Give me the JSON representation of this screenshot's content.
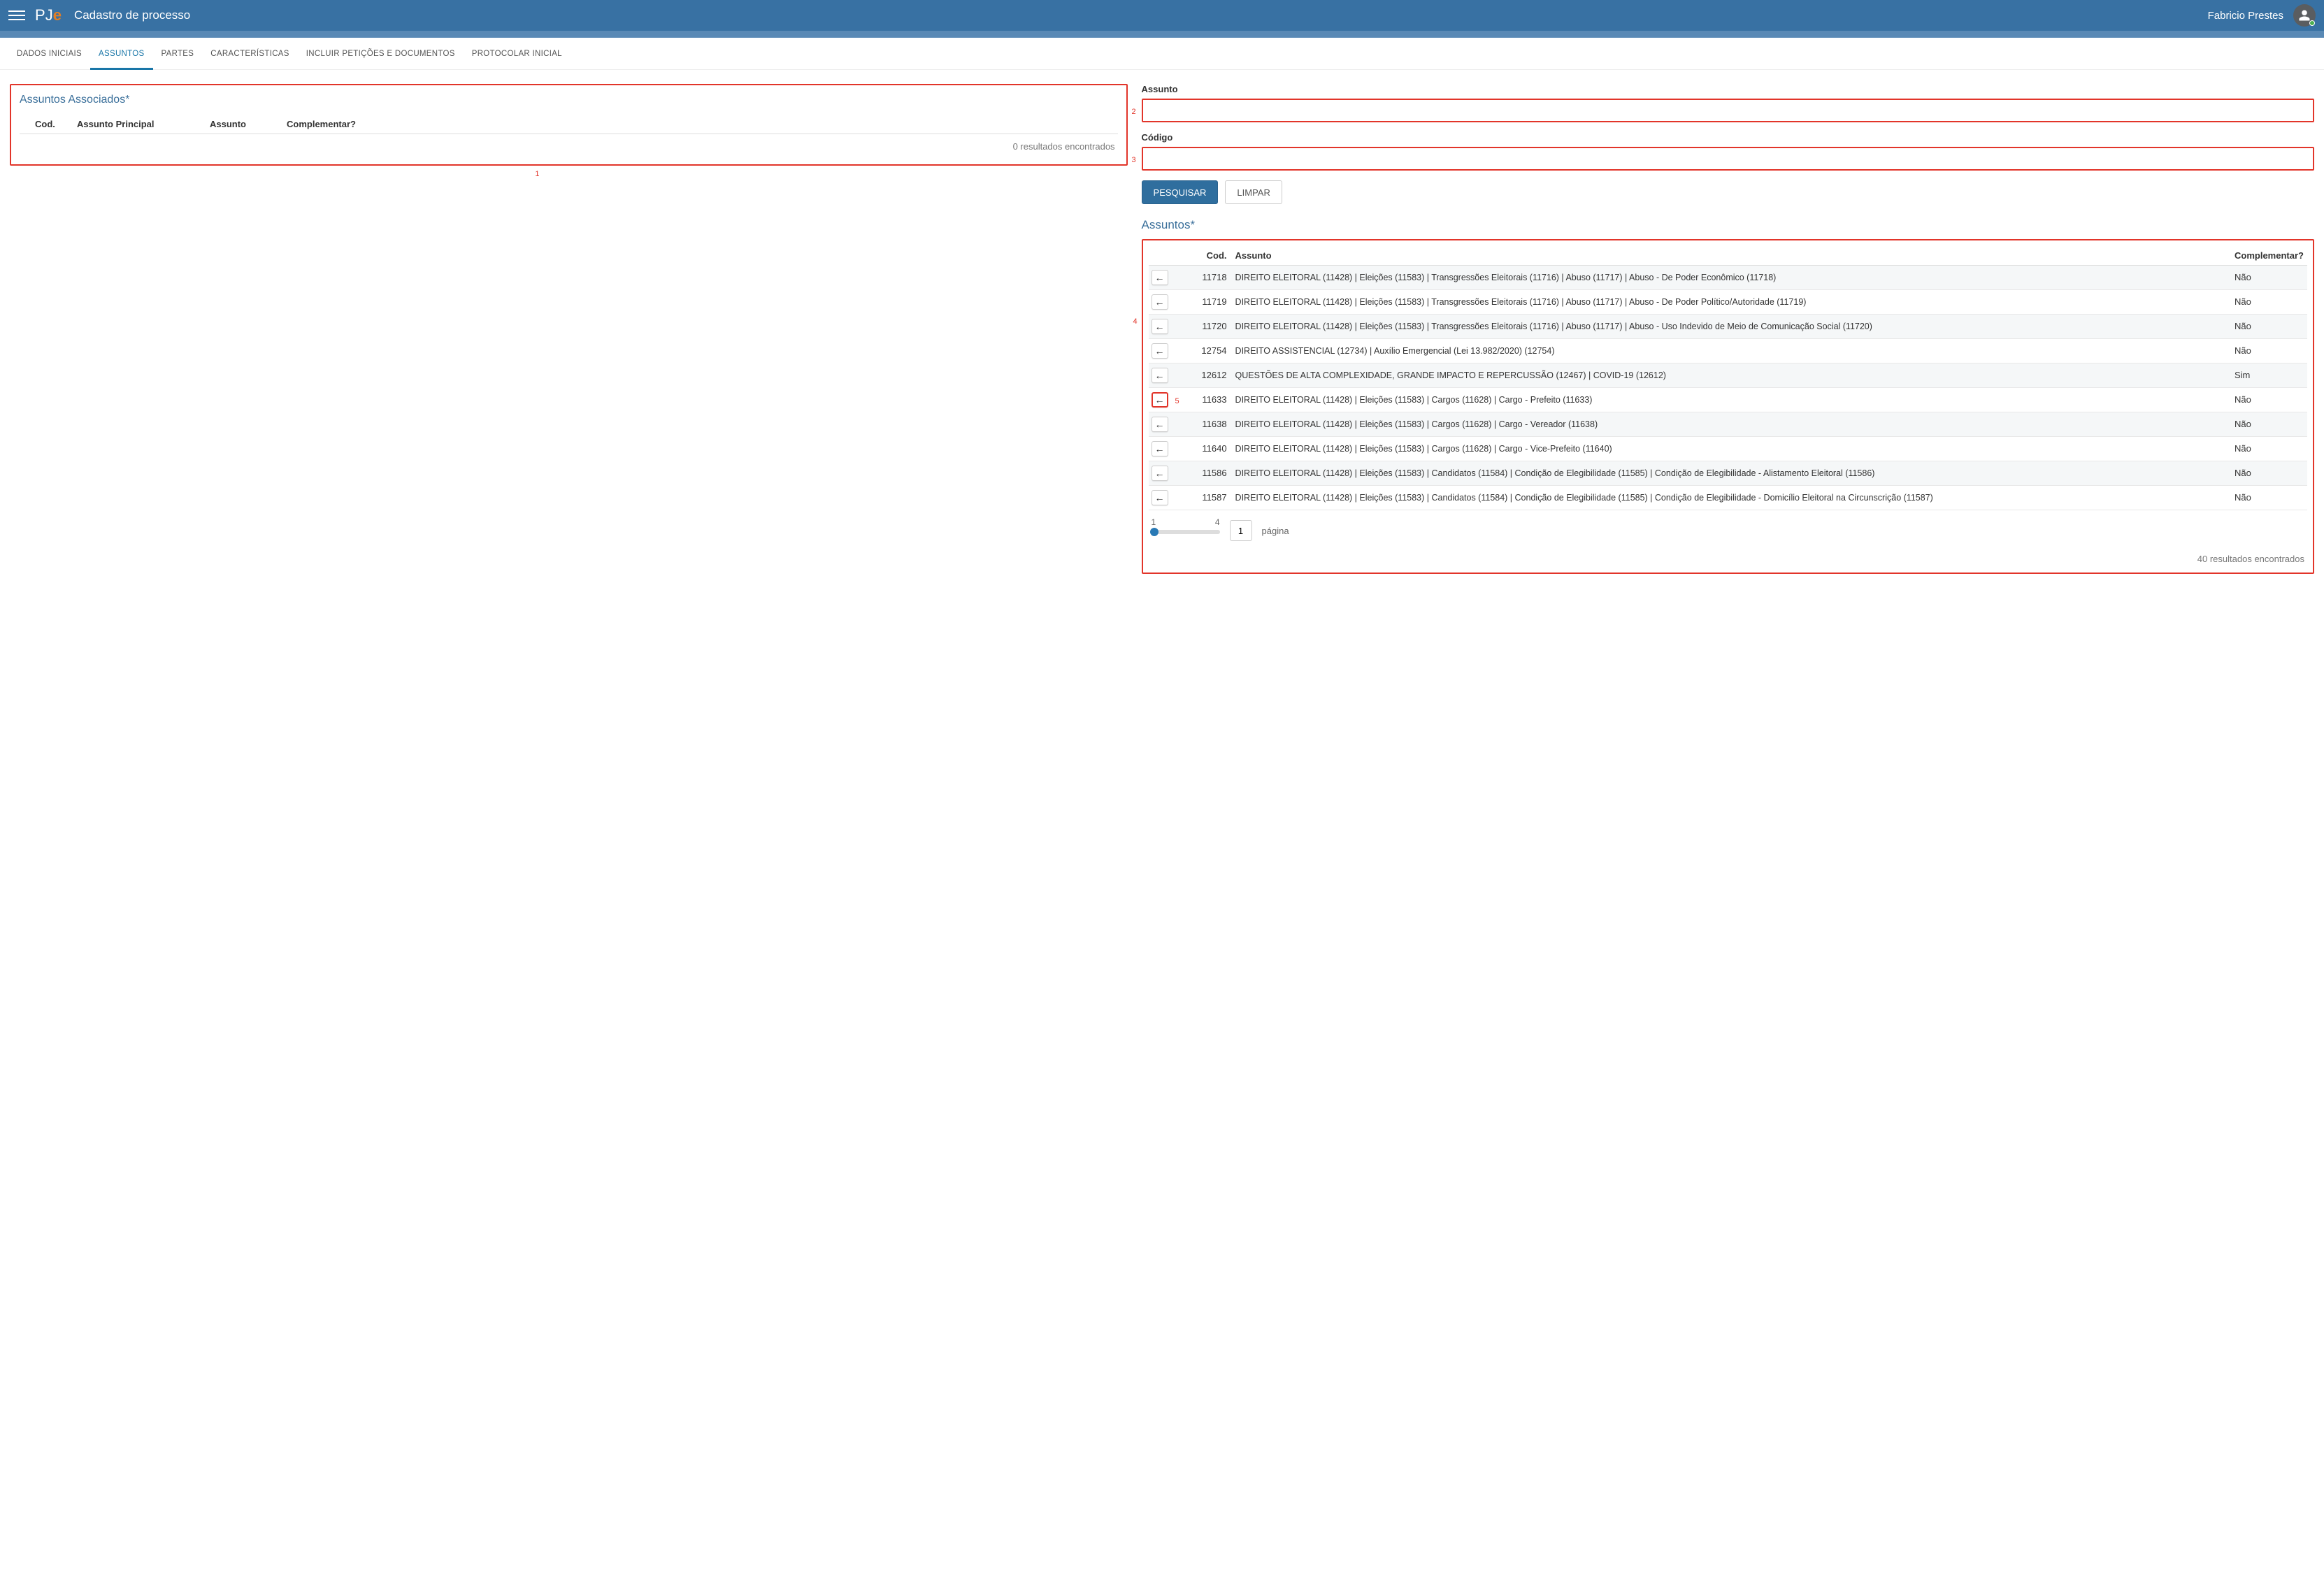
{
  "header": {
    "page_title": "Cadastro de processo",
    "user_name": "Fabricio Prestes",
    "logo_p": "P",
    "logo_j": "J",
    "logo_e": "e"
  },
  "tabs": [
    {
      "label": "DADOS INICIAIS",
      "active": false
    },
    {
      "label": "ASSUNTOS",
      "active": true
    },
    {
      "label": "PARTES",
      "active": false
    },
    {
      "label": "CARACTERÍSTICAS",
      "active": false
    },
    {
      "label": "INCLUIR PETIÇÕES E DOCUMENTOS",
      "active": false
    },
    {
      "label": "PROTOCOLAR INICIAL",
      "active": false
    }
  ],
  "left": {
    "title": "Assuntos Associados*",
    "cols": {
      "cod": "Cod.",
      "principal": "Assunto Principal",
      "assunto": "Assunto",
      "comp": "Complementar?"
    },
    "empty": "0 resultados encontrados",
    "callout": "1"
  },
  "search": {
    "assunto_label": "Assunto",
    "assunto_callout": "2",
    "codigo_label": "Código",
    "codigo_callout": "3",
    "btn_search": "PESQUISAR",
    "btn_clear": "LIMPAR"
  },
  "results": {
    "title": "Assuntos*",
    "callout_box": "4",
    "callout_row": "5",
    "cols": {
      "cod": "Cod.",
      "assunto": "Assunto",
      "comp": "Complementar?"
    },
    "rows": [
      {
        "cod": "11718",
        "desc": "DIREITO ELEITORAL (11428) | Eleições (11583) | Transgressões Eleitorais (11716) | Abuso (11717) | Abuso - De Poder Econômico (11718)",
        "comp": "Não",
        "highlight": false
      },
      {
        "cod": "11719",
        "desc": "DIREITO ELEITORAL (11428) | Eleições (11583) | Transgressões Eleitorais (11716) | Abuso (11717) | Abuso - De Poder Político/Autoridade (11719)",
        "comp": "Não",
        "highlight": false
      },
      {
        "cod": "11720",
        "desc": "DIREITO ELEITORAL (11428) | Eleições (11583) | Transgressões Eleitorais (11716) | Abuso (11717) | Abuso - Uso Indevido de Meio de Comunicação Social (11720)",
        "comp": "Não",
        "highlight": false
      },
      {
        "cod": "12754",
        "desc": "DIREITO ASSISTENCIAL (12734) | Auxílio Emergencial (Lei 13.982/2020) (12754)",
        "comp": "Não",
        "highlight": false
      },
      {
        "cod": "12612",
        "desc": "QUESTÕES DE ALTA COMPLEXIDADE, GRANDE IMPACTO E REPERCUSSÃO (12467) | COVID-19 (12612)",
        "comp": "Sim",
        "highlight": false
      },
      {
        "cod": "11633",
        "desc": "DIREITO ELEITORAL (11428) | Eleições (11583) | Cargos (11628) | Cargo - Prefeito (11633)",
        "comp": "Não",
        "highlight": true
      },
      {
        "cod": "11638",
        "desc": "DIREITO ELEITORAL (11428) | Eleições (11583) | Cargos (11628) | Cargo - Vereador (11638)",
        "comp": "Não",
        "highlight": false
      },
      {
        "cod": "11640",
        "desc": "DIREITO ELEITORAL (11428) | Eleições (11583) | Cargos (11628) | Cargo - Vice-Prefeito (11640)",
        "comp": "Não",
        "highlight": false
      },
      {
        "cod": "11586",
        "desc": "DIREITO ELEITORAL (11428) | Eleições (11583) | Candidatos (11584) | Condição de Elegibilidade (11585) | Condição de Elegibilidade - Alistamento Eleitoral (11586)",
        "comp": "Não",
        "highlight": false
      },
      {
        "cod": "11587",
        "desc": "DIREITO ELEITORAL (11428) | Eleições (11583) | Candidatos (11584) | Condição de Elegibilidade (11585) | Condição de Elegibilidade - Domicílio Eleitoral na Circunscrição (11587)",
        "comp": "Não",
        "highlight": false
      }
    ],
    "pager": {
      "start": "1",
      "end": "4",
      "current": "1",
      "label": "página"
    },
    "count": "40 resultados encontrados"
  }
}
